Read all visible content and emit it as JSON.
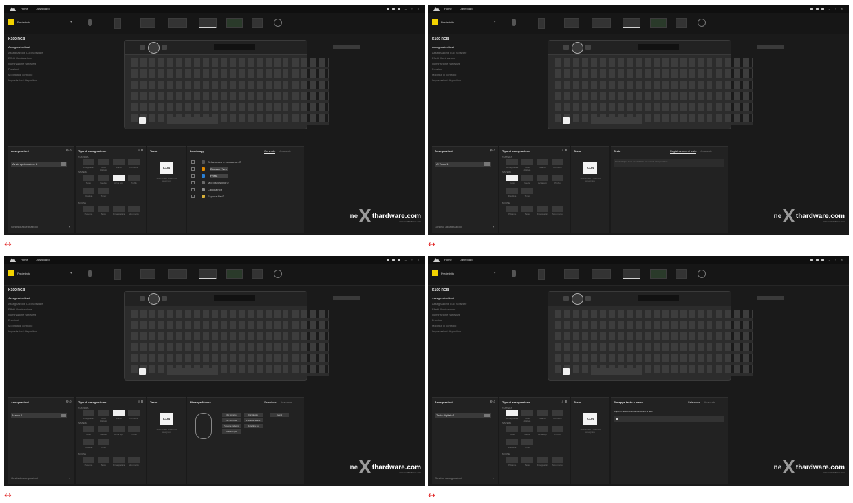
{
  "window": {
    "tabs": [
      "Home",
      "Dashboard"
    ],
    "window_controls": "– ▫ ×"
  },
  "device_bar": {
    "profile_name": "Predefinito",
    "profile_color": "#f2d200"
  },
  "device": {
    "title": "K100 RGB",
    "menu": [
      "Assegnazioni tasti",
      "Assegnazione Luci Software",
      "Effetti illuminazione",
      "Illuminazione hardware",
      "Funzioni",
      "Modifica di controllo",
      "Impostazioni dispositivo"
    ]
  },
  "assignments": {
    "title": "Assegnazioni",
    "footer": "Gestisci assegnazioni"
  },
  "types": {
    "title": "Tipo di assegnazione",
    "section_keyboard": "TASTIERA",
    "section_system": "SISTEMA",
    "section_mouse": "MOUSE",
    "row1_labels": [
      "Rimappatura",
      "Testo digitato",
      "Macro",
      "Funzione"
    ],
    "row2_labels": [
      "Testo",
      "Media",
      "Avvia app",
      "Profilo"
    ],
    "row3_labels": [
      "Disattiva",
      "Timer"
    ],
    "row4_labels": [
      "Pulsante",
      "Tasto",
      "Rimappatura",
      "Movimento"
    ]
  },
  "tasto": {
    "title": "Tasto",
    "preview": "ICON",
    "caption": "Selezionare il tasto da assegnare"
  },
  "shots": [
    {
      "assign_row": "Avvio applicazione 1",
      "type_selected_row": 2,
      "type_selected_index": 2,
      "right_title": "Lancia app",
      "right_tabs": [
        "Generale",
        "Avanzate"
      ],
      "apps": [
        {
          "name": "Selezionare o cercare un",
          "icon": "#555555",
          "dropdown": false
        },
        {
          "name": "Browser Web",
          "icon": "#e08a00",
          "dropdown": true
        },
        {
          "name": "Posta",
          "icon": "#2a7fd4",
          "dropdown": true
        },
        {
          "name": "Mio dispositivo",
          "icon": "#6a6a6a",
          "dropdown": false
        },
        {
          "name": "Calcolatrice",
          "icon": "#8a8a8a",
          "dropdown": false
        },
        {
          "name": "Esplora file",
          "icon": "#d8b03a",
          "dropdown": false
        }
      ]
    },
    {
      "assign_row": "Al Tasto 1",
      "type_selected_row": 2,
      "type_selected_index": 0,
      "right_title": "Testo",
      "right_tabs": [
        "Registrazione di testo",
        "Avanzate"
      ],
      "text_note": "Inserisci qui il testo da utilizzare per questa assegnazione"
    },
    {
      "assign_row": "Macro 1",
      "type_selected_row": 1,
      "type_selected_index": 2,
      "right_title": "Rimappa Mouse",
      "right_tabs": [
        "Selezione",
        "Avanzate"
      ],
      "mouse_buttons": [
        "Clic sinistro",
        "Clic destro",
        "Clic centrale",
        "Pulsante avanti",
        "Pulsante indietro",
        "Rotellina su",
        "Rotellina giù",
        "Avanti"
      ]
    },
    {
      "assign_row": "Testo digitato 1",
      "type_selected_row": 1,
      "type_selected_index": 0,
      "right_title": "Rimappa tasto a mano",
      "right_tabs": [
        "Selezione",
        "Avanzate"
      ],
      "rec_prompt": "Digita un tasto o una combinazione di tasti"
    }
  ],
  "watermark": {
    "prefix": "ne",
    "x": "X",
    "main": "thardware.com",
    "sub": "www.nexthardware.com"
  },
  "arrow_glyph": "↔"
}
